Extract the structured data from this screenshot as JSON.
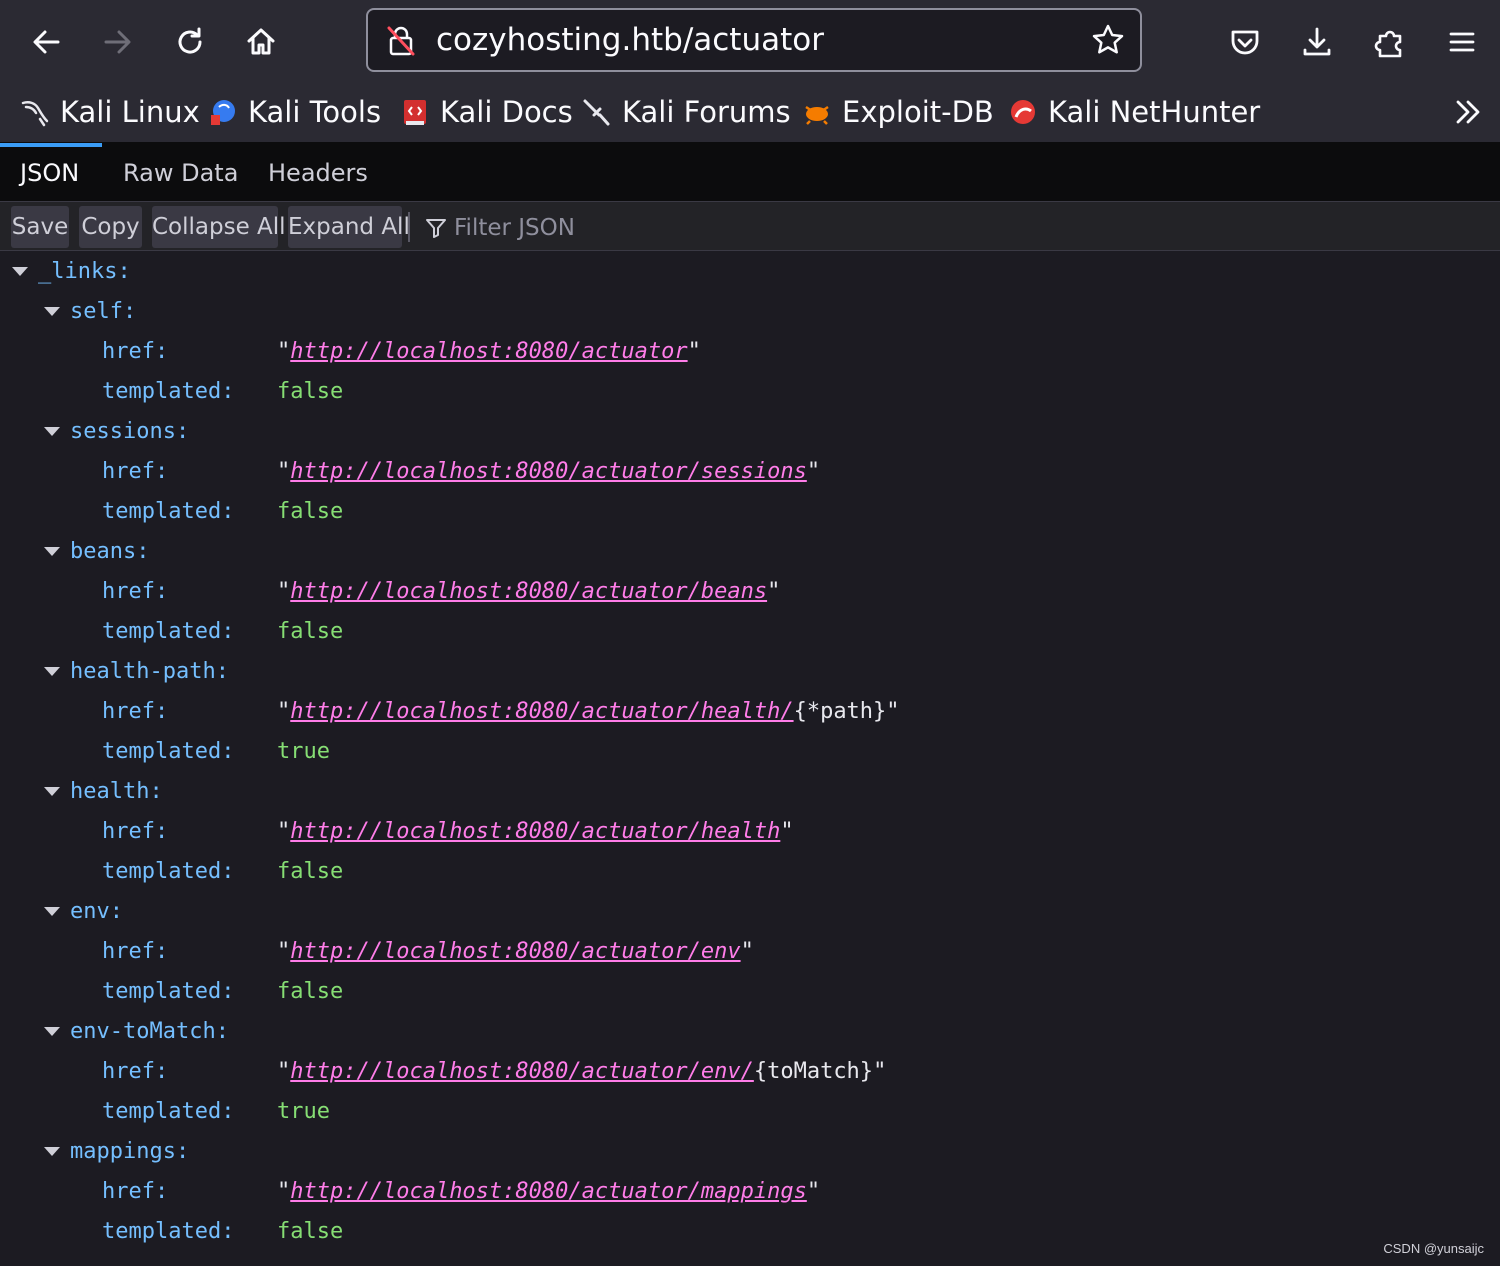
{
  "browser": {
    "url": "cozyhosting.htb/actuator",
    "bookmarks": [
      {
        "label": "Kali Linux",
        "icon": "kali-dragon-icon"
      },
      {
        "label": "Kali Tools",
        "icon": "kali-tools-icon"
      },
      {
        "label": "Kali Docs",
        "icon": "kali-docs-icon"
      },
      {
        "label": "Kali Forums",
        "icon": "kali-forums-icon"
      },
      {
        "label": "Exploit-DB",
        "icon": "exploit-db-icon"
      },
      {
        "label": "Kali NetHunter",
        "icon": "nethunter-icon"
      }
    ]
  },
  "viewer": {
    "tabs": [
      "JSON",
      "Raw Data",
      "Headers"
    ],
    "active_tab": "JSON",
    "toolbar": {
      "save": "Save",
      "copy": "Copy",
      "collapse_all": "Collapse All",
      "expand_all": "Expand All",
      "filter_placeholder": "Filter JSON"
    }
  },
  "json": {
    "root_key": "_links:",
    "href_key": "href:",
    "templated_key": "templated:",
    "entries": [
      {
        "key": "self:",
        "href_link": "http://localhost:8080/actuator",
        "href_suffix": "",
        "templated": "false"
      },
      {
        "key": "sessions:",
        "href_link": "http://localhost:8080/actuator/sessions",
        "href_suffix": "",
        "templated": "false"
      },
      {
        "key": "beans:",
        "href_link": "http://localhost:8080/actuator/beans",
        "href_suffix": "",
        "templated": "false"
      },
      {
        "key": "health-path:",
        "href_link": "http://localhost:8080/actuator/health/",
        "href_suffix": "{*path}",
        "templated": "true"
      },
      {
        "key": "health:",
        "href_link": "http://localhost:8080/actuator/health",
        "href_suffix": "",
        "templated": "false"
      },
      {
        "key": "env:",
        "href_link": "http://localhost:8080/actuator/env",
        "href_suffix": "",
        "templated": "false"
      },
      {
        "key": "env-toMatch:",
        "href_link": "http://localhost:8080/actuator/env/",
        "href_suffix": "{toMatch}",
        "templated": "true"
      },
      {
        "key": "mappings:",
        "href_link": "http://localhost:8080/actuator/mappings",
        "href_suffix": "",
        "templated": "false"
      }
    ]
  },
  "watermark": "CSDN @yunsaijc"
}
